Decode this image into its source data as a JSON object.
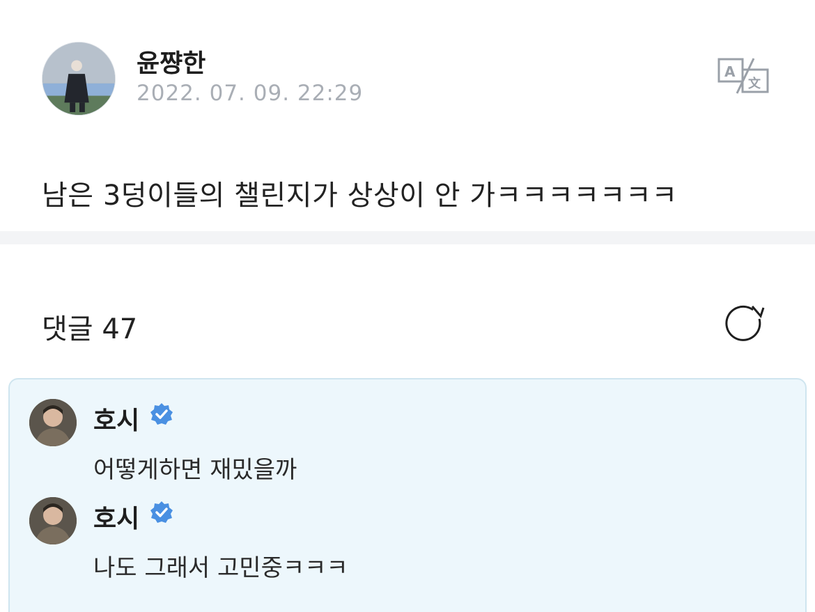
{
  "post": {
    "author": "윤쨩한",
    "date": "2022. 07. 09. 22:29",
    "body": "남은 3덩이들의 챌린지가 상상이 안 가ㅋㅋㅋㅋㅋㅋㅋ",
    "translate_icon": "translate-icon"
  },
  "comments_section": {
    "title": "댓글 47",
    "refresh_icon": "refresh-icon"
  },
  "comments": [
    {
      "author": "호시",
      "verified": true,
      "text": "어떻게하면 재밌을까"
    },
    {
      "author": "호시",
      "verified": true,
      "text": "나도 그래서 고민중ㅋㅋㅋ"
    }
  ],
  "colors": {
    "verified_badge": "#4a90e2",
    "comment_bg": "#edf7fc",
    "date_text": "#a9aeb5",
    "divider": "#f3f4f6"
  }
}
